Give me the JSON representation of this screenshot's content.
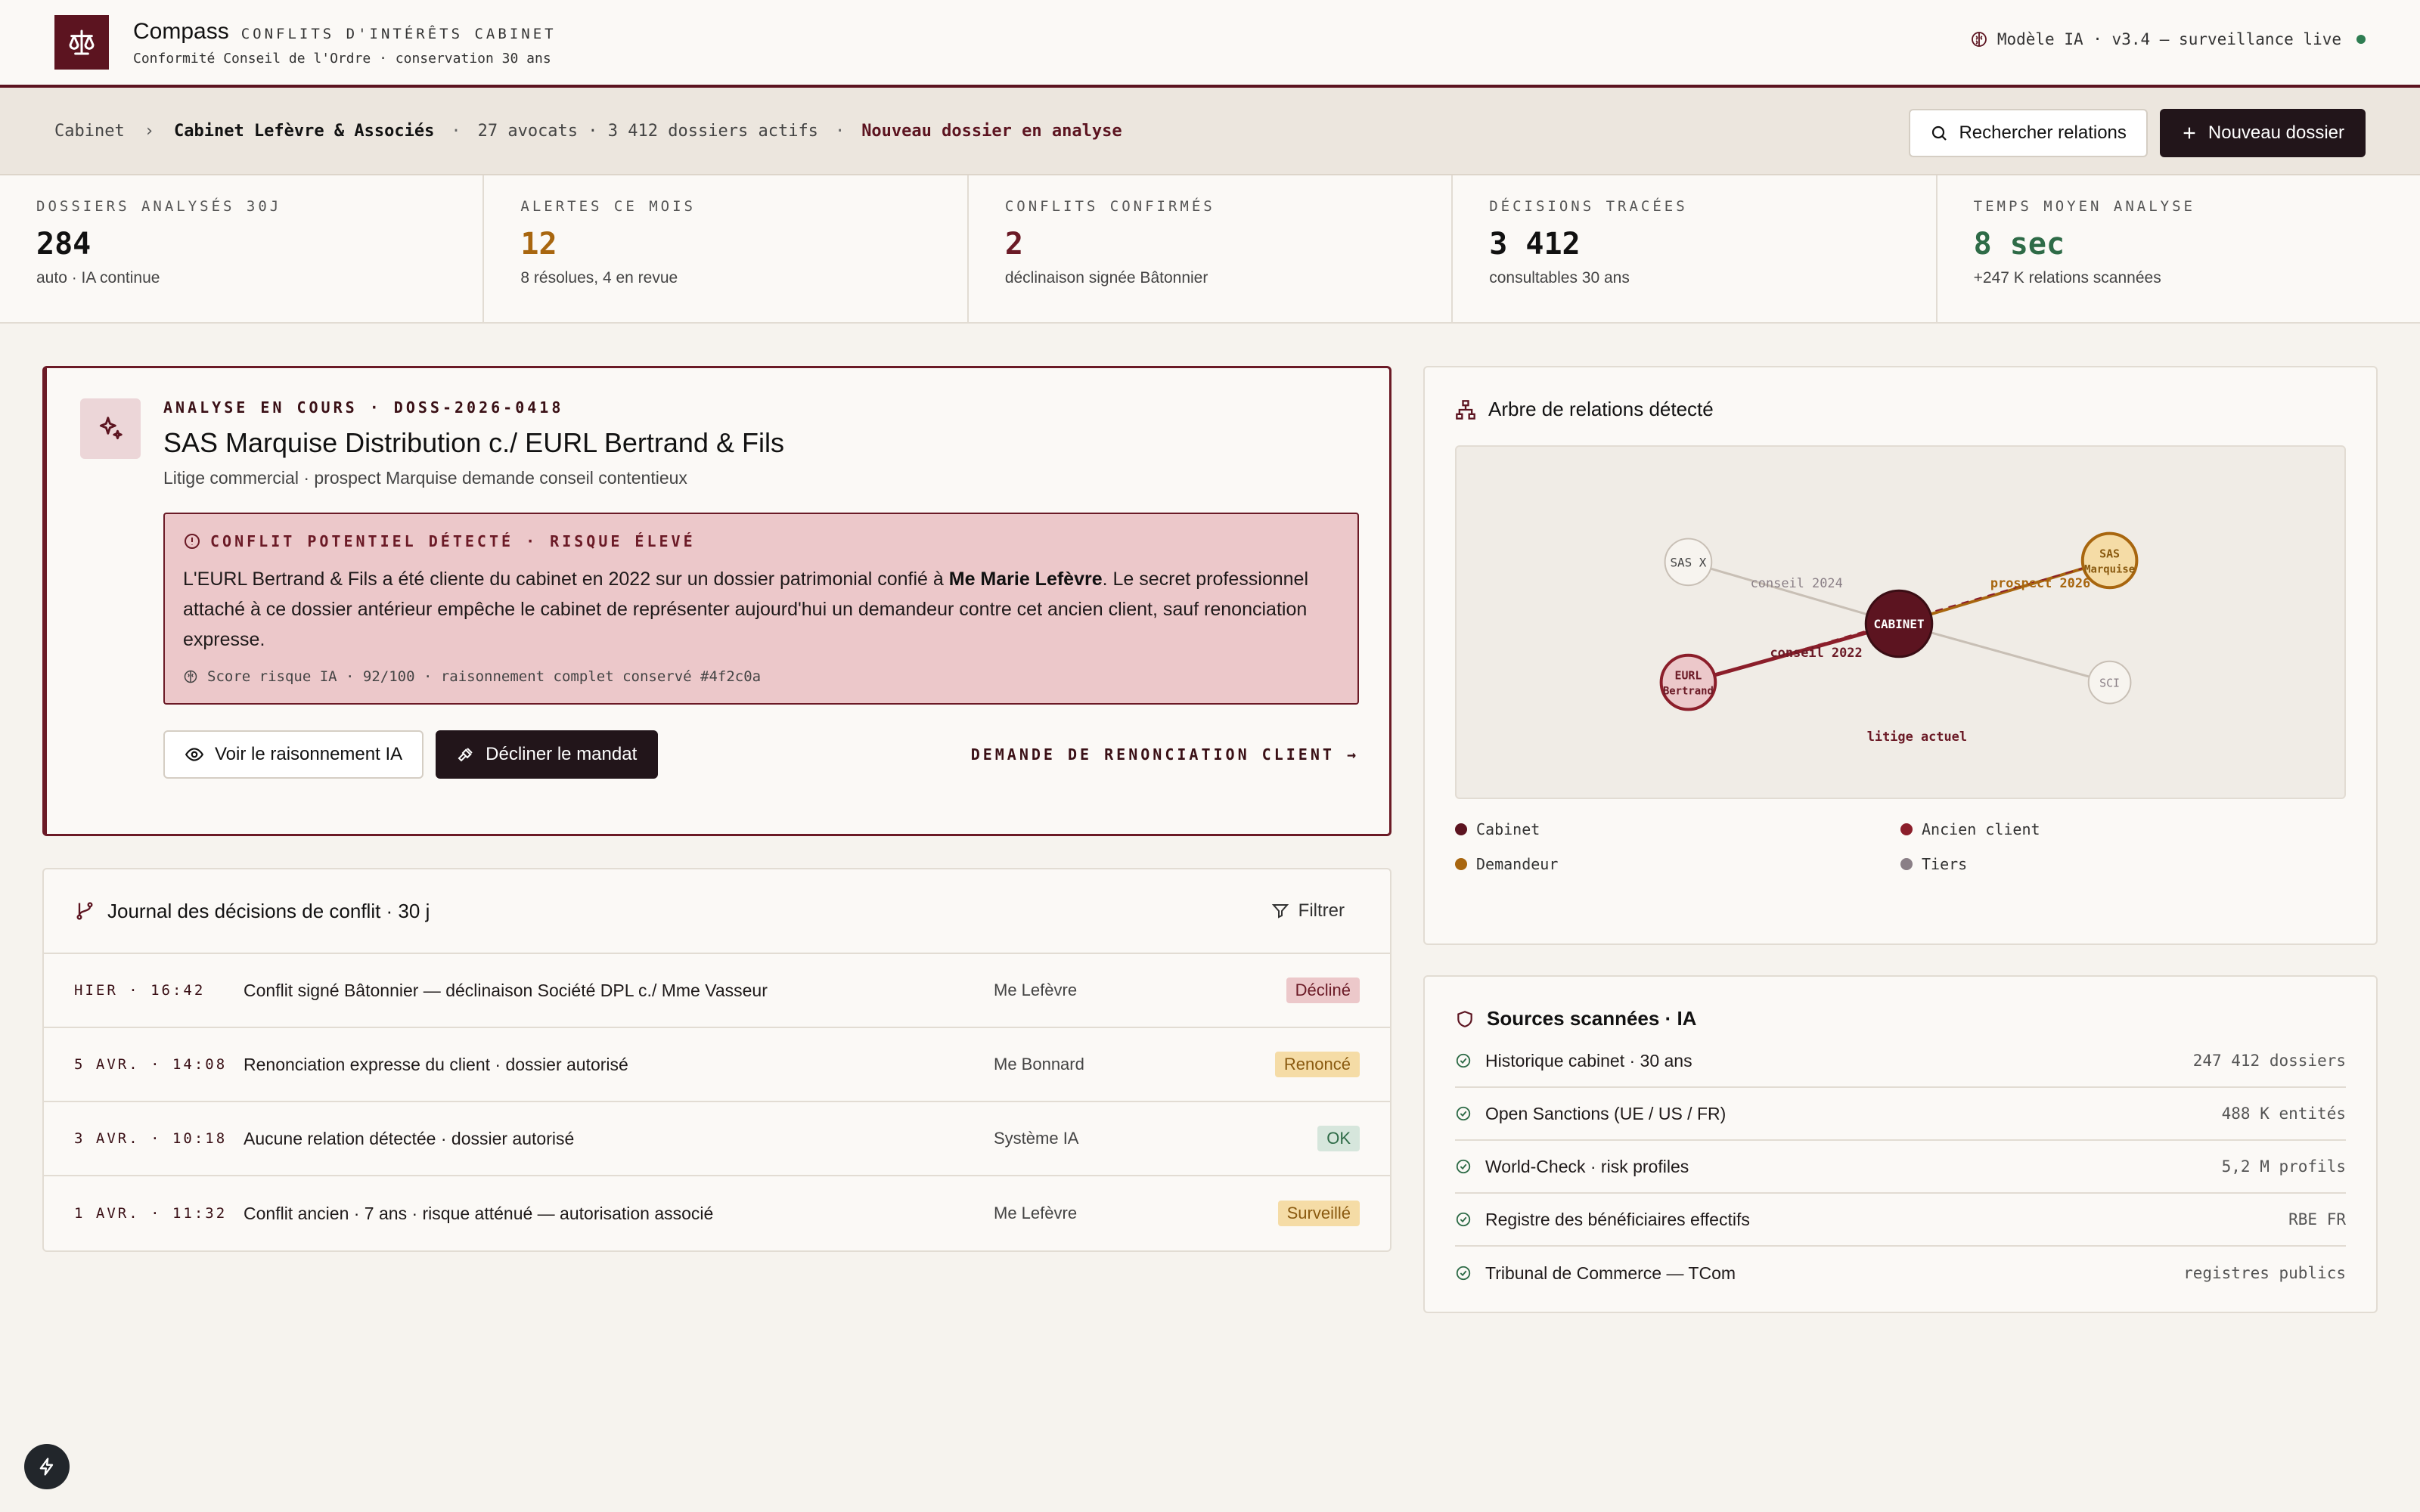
{
  "header": {
    "brand": "Compass",
    "tagline": "CONFLITS D'INTÉRÊTS CABINET",
    "subtitle": "Conformité Conseil de l'Ordre · conservation 30 ans",
    "model_status": "Modèle IA · v3.4 — surveillance live"
  },
  "breadcrumb": {
    "root": "Cabinet",
    "current": "Cabinet Lefèvre & Associés",
    "meta": "27 avocats · 3 412 dossiers actifs",
    "alert": "Nouveau dossier en analyse"
  },
  "actions": {
    "search_label": "Rechercher relations",
    "new_label": "Nouveau dossier"
  },
  "stats": [
    {
      "label": "DOSSIERS ANALYSÉS 30J",
      "value": "284",
      "sub": "auto · IA continue",
      "color": "#111111"
    },
    {
      "label": "ALERTES CE MOIS",
      "value": "12",
      "sub": "8 résolues, 4 en revue",
      "color": "#a8660f"
    },
    {
      "label": "CONFLITS CONFIRMÉS",
      "value": "2",
      "sub": "déclinaison signée Bâtonnier",
      "color": "#6b1a26"
    },
    {
      "label": "DÉCISIONS TRACÉES",
      "value": "3 412",
      "sub": "consultables 30 ans",
      "color": "#111111"
    },
    {
      "label": "TEMPS MOYEN ANALYSE",
      "value": "8 sec",
      "sub": "+247 K relations scannées",
      "color": "#2e6b47"
    }
  ],
  "analysis": {
    "eyebrow": "ANALYSE EN COURS · DOSS-2026-0418",
    "title": "SAS Marquise Distribution c./ EURL Bertrand & Fils",
    "subtitle": "Litige commercial · prospect Marquise demande conseil contentieux",
    "alert_head": "CONFLIT POTENTIEL DÉTECTÉ · RISQUE ÉLEVÉ",
    "alert_text_1": "L'EURL Bertrand & Fils a été cliente du cabinet en 2022 sur un dossier patrimonial confié à ",
    "alert_text_bold": "Me Marie Lefèvre",
    "alert_text_2": ". Le secret professionnel attaché à ce dossier antérieur empêche le cabinet de représenter aujourd'hui un demandeur contre cet ancien client, sauf renonciation expresse.",
    "score": "Score risque IA · 92/100 · raisonnement complet conservé #4f2c0a",
    "btn_reasoning": "Voir le raisonnement IA",
    "btn_decline": "Décliner le mandat",
    "link_renounce": "DEMANDE DE RENONCIATION CLIENT →"
  },
  "journal": {
    "title": "Journal des décisions de conflit · 30 j",
    "filter": "Filtrer",
    "rows": [
      {
        "date": "HIER · 16:42",
        "desc": "Conflit signé Bâtonnier — déclinaison Société DPL c./ Mme Vasseur",
        "author": "Me Lefèvre",
        "status": "Décliné",
        "cls": "b-decline"
      },
      {
        "date": "5 AVR. · 14:08",
        "desc": "Renonciation expresse du client · dossier autorisé",
        "author": "Me Bonnard",
        "status": "Renoncé",
        "cls": "b-renonce"
      },
      {
        "date": "3 AVR. · 10:18",
        "desc": "Aucune relation détectée · dossier autorisé",
        "author": "Système IA",
        "status": "OK",
        "cls": "b-ok"
      },
      {
        "date": "1 AVR. · 11:32",
        "desc": "Conflit ancien · 7 ans · risque atténué — autorisation associé",
        "author": "Me Lefèvre",
        "status": "Surveillé",
        "cls": "b-surv"
      }
    ]
  },
  "tree": {
    "title": "Arbre de relations détecté",
    "nodes": {
      "cabinet": "CABINET",
      "sas_line1": "SAS",
      "sas_line2": "Marquise",
      "eurl_line1": "EURL",
      "eurl_line2": "Bertrand",
      "sasx": "SAS X",
      "sci": "SCI"
    },
    "edges": {
      "conseil2024": "conseil 2024",
      "prospect2026": "prospect 2026",
      "conseil2022": "conseil 2022",
      "litige": "litige actuel"
    },
    "legend": [
      {
        "label": "Cabinet",
        "color": "#5c1420"
      },
      {
        "label": "Ancien client",
        "color": "#8b1e2a"
      },
      {
        "label": "Demandeur",
        "color": "#a8660f"
      },
      {
        "label": "Tiers",
        "color": "#8a7f86"
      }
    ]
  },
  "sources": {
    "title": "Sources scannées · IA",
    "rows": [
      {
        "name": "Historique cabinet · 30 ans",
        "value": "247 412 dossiers"
      },
      {
        "name": "Open Sanctions (UE / US / FR)",
        "value": "488 K entités"
      },
      {
        "name": "World-Check · risk profiles",
        "value": "5,2 M profils"
      },
      {
        "name": "Registre des bénéficiaires effectifs",
        "value": "RBE FR"
      },
      {
        "name": "Tribunal de Commerce — TCom",
        "value": "registres publics"
      }
    ]
  }
}
